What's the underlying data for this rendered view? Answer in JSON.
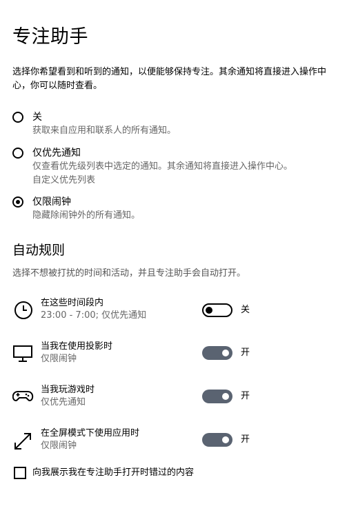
{
  "page": {
    "title": "专注助手",
    "description": "选择你希望看到和听到的通知，以便能够保持专注。其余通知将直接进入操作中心，你可以随时查看。"
  },
  "modes": [
    {
      "label": "关",
      "description": "获取来自应用和联系人的所有通知。",
      "selected": false
    },
    {
      "label": "仅优先通知",
      "description": "仅查看优先级列表中选定的通知。其余通知将直接进入操作中心。",
      "link": "自定义优先列表",
      "selected": false
    },
    {
      "label": "仅限闹钟",
      "description": "隐藏除闹钟外的所有通知。",
      "selected": true
    }
  ],
  "auto_rules": {
    "title": "自动规则",
    "description": "选择不想被打扰的时间和活动，并且专注助手会自动打开。",
    "rules": [
      {
        "name": "在这些时间段内",
        "detail": "23:00 - 7:00; 仅优先通知",
        "icon": "clock-icon",
        "state_label": "关",
        "on": false
      },
      {
        "name": "当我在使用投影时",
        "detail": "仅限闹钟",
        "icon": "monitor-icon",
        "state_label": "开",
        "on": true
      },
      {
        "name": "当我玩游戏时",
        "detail": "仅优先通知",
        "icon": "gamepad-icon",
        "state_label": "开",
        "on": true
      },
      {
        "name": "在全屏模式下使用应用时",
        "detail": "仅限闹钟",
        "icon": "fullscreen-arrows-icon",
        "state_label": "开",
        "on": true
      }
    ]
  },
  "summary_checkbox": {
    "label": "向我展示我在专注助手打开时错过的内容",
    "checked": false
  },
  "colors": {
    "toggle_on": "#5a6371",
    "secondary_text": "#666666"
  }
}
